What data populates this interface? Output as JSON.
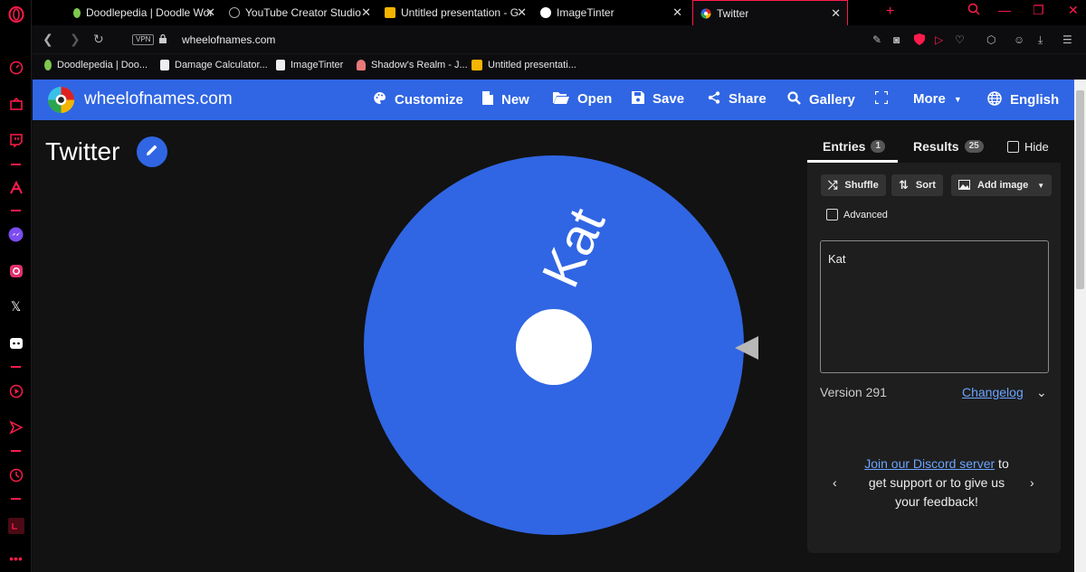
{
  "browser": {
    "tabs": [
      {
        "label": "Doodlepedia | Doodle Wor",
        "active": false
      },
      {
        "label": "YouTube Creator Studio",
        "active": false
      },
      {
        "label": "Untitled presentation - Goo",
        "active": false
      },
      {
        "label": "ImageTinter",
        "active": false
      },
      {
        "label": "Twitter",
        "active": true
      }
    ],
    "new_tab": "+",
    "vpn_label": "VPN",
    "url": "wheelofnames.com",
    "bookmarks": [
      {
        "label": "Doodlepedia | Doo..."
      },
      {
        "label": "Damage Calculator..."
      },
      {
        "label": "ImageTinter"
      },
      {
        "label": "Shadow's Realm - J..."
      },
      {
        "label": "Untitled presentati..."
      }
    ],
    "accent_color": "#ff1b4b"
  },
  "site": {
    "title": "wheelofnames.com",
    "brand_color": "#3066e3",
    "menu": [
      {
        "label": "Customize",
        "icon": "palette-icon"
      },
      {
        "label": "New",
        "icon": "file-icon"
      },
      {
        "label": "Open",
        "icon": "folder-open-icon"
      },
      {
        "label": "Save",
        "icon": "save-icon"
      },
      {
        "label": "Share",
        "icon": "share-icon"
      },
      {
        "label": "Gallery",
        "icon": "search-icon"
      },
      {
        "label": "",
        "icon": "fullscreen-icon"
      },
      {
        "label": "More",
        "icon": "caret-down-icon"
      },
      {
        "label": "English",
        "icon": "globe-icon"
      }
    ]
  },
  "wheel": {
    "title": "Twitter",
    "entry_text": "Kat",
    "color": "#3066e3"
  },
  "panel": {
    "entries_tab": "Entries",
    "entries_count": "1",
    "results_tab": "Results",
    "results_count": "25",
    "hide_label": "Hide",
    "shuffle_label": "Shuffle",
    "sort_label": "Sort",
    "add_image_label": "Add image",
    "advanced_label": "Advanced",
    "entries_text": "Kat",
    "version": "Version 291",
    "changelog": "Changelog",
    "discord_link": "Join our Discord server",
    "discord_rest": " to get support or to give us your feedback!"
  }
}
